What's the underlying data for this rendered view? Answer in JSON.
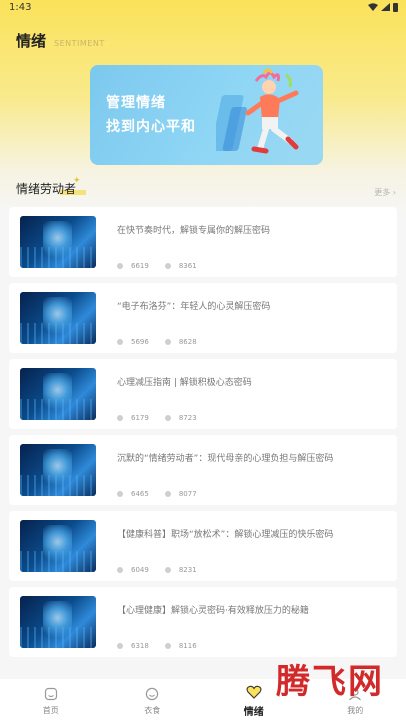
{
  "status_bar": {
    "time": "1:43"
  },
  "header": {
    "title": "情绪",
    "subtitle": "SENTIMENT"
  },
  "banner": {
    "line1": "管理情绪",
    "line2": "找到内心平和"
  },
  "section": {
    "title": "情绪劳动者",
    "more": "更多 ›"
  },
  "articles": [
    {
      "title": "在快节奏时代，解锁专属你的解压密码",
      "views": "6619",
      "likes": "8361"
    },
    {
      "title": "“电子布洛芬”：年轻人的心灵解压密码",
      "views": "5696",
      "likes": "8628"
    },
    {
      "title": "心理减压指南 | 解锁积极心态密码",
      "views": "6179",
      "likes": "8723"
    },
    {
      "title": "沉默的“情绪劳动者”：现代母亲的心理负担与解压密码",
      "views": "6465",
      "likes": "8077"
    },
    {
      "title": "【健康科普】职场“放松术”：解锁心理减压的快乐密码",
      "views": "6049",
      "likes": "8231"
    },
    {
      "title": "【心理健康】解锁心灵密码·有效释放压力的秘籍",
      "views": "6318",
      "likes": "8116"
    }
  ],
  "tabbar": {
    "tabs": [
      {
        "label": "首页"
      },
      {
        "label": "衣食"
      },
      {
        "label": "情绪"
      },
      {
        "label": "我的"
      }
    ]
  },
  "watermark": {
    "text": "腾飞网"
  },
  "colors": {
    "accent_yellow": "#fbe25a",
    "banner_blue": "#8fd6f5",
    "watermark_red": "#d22a2a"
  }
}
